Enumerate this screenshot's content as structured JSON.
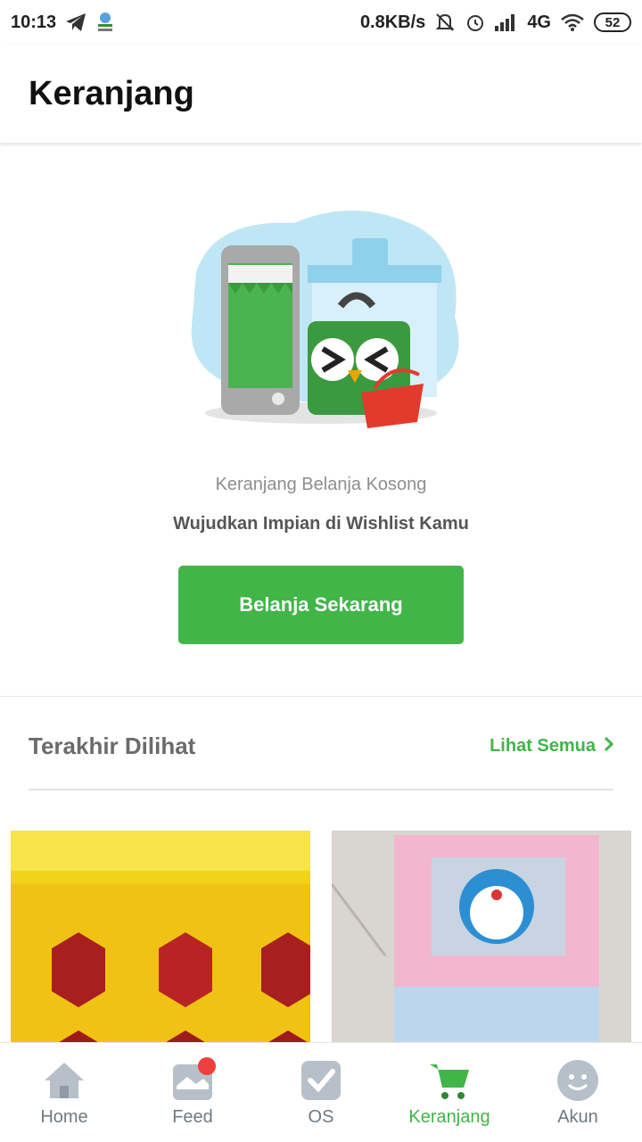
{
  "status_bar": {
    "time": "10:13",
    "net_speed": "0.8KB/s",
    "network": "4G",
    "battery": "52"
  },
  "header": {
    "title": "Keranjang"
  },
  "empty_state": {
    "title": "Keranjang Belanja Kosong",
    "subtitle": "Wujudkan Impian di Wishlist Kamu",
    "button_label": "Belanja Sekarang"
  },
  "recent": {
    "title": "Terakhir Dilihat",
    "see_all_label": "Lihat Semua"
  },
  "colors": {
    "accent": "#42b549",
    "badge": "#ef3f3f",
    "inactive": "#6f7a83"
  },
  "bottom_nav": {
    "items": [
      {
        "label": "Home",
        "icon": "home-icon"
      },
      {
        "label": "Feed",
        "icon": "feed-icon"
      },
      {
        "label": "OS",
        "icon": "official-store-icon"
      },
      {
        "label": "Keranjang",
        "icon": "cart-icon"
      },
      {
        "label": "Akun",
        "icon": "account-icon"
      }
    ],
    "active": "Keranjang"
  }
}
